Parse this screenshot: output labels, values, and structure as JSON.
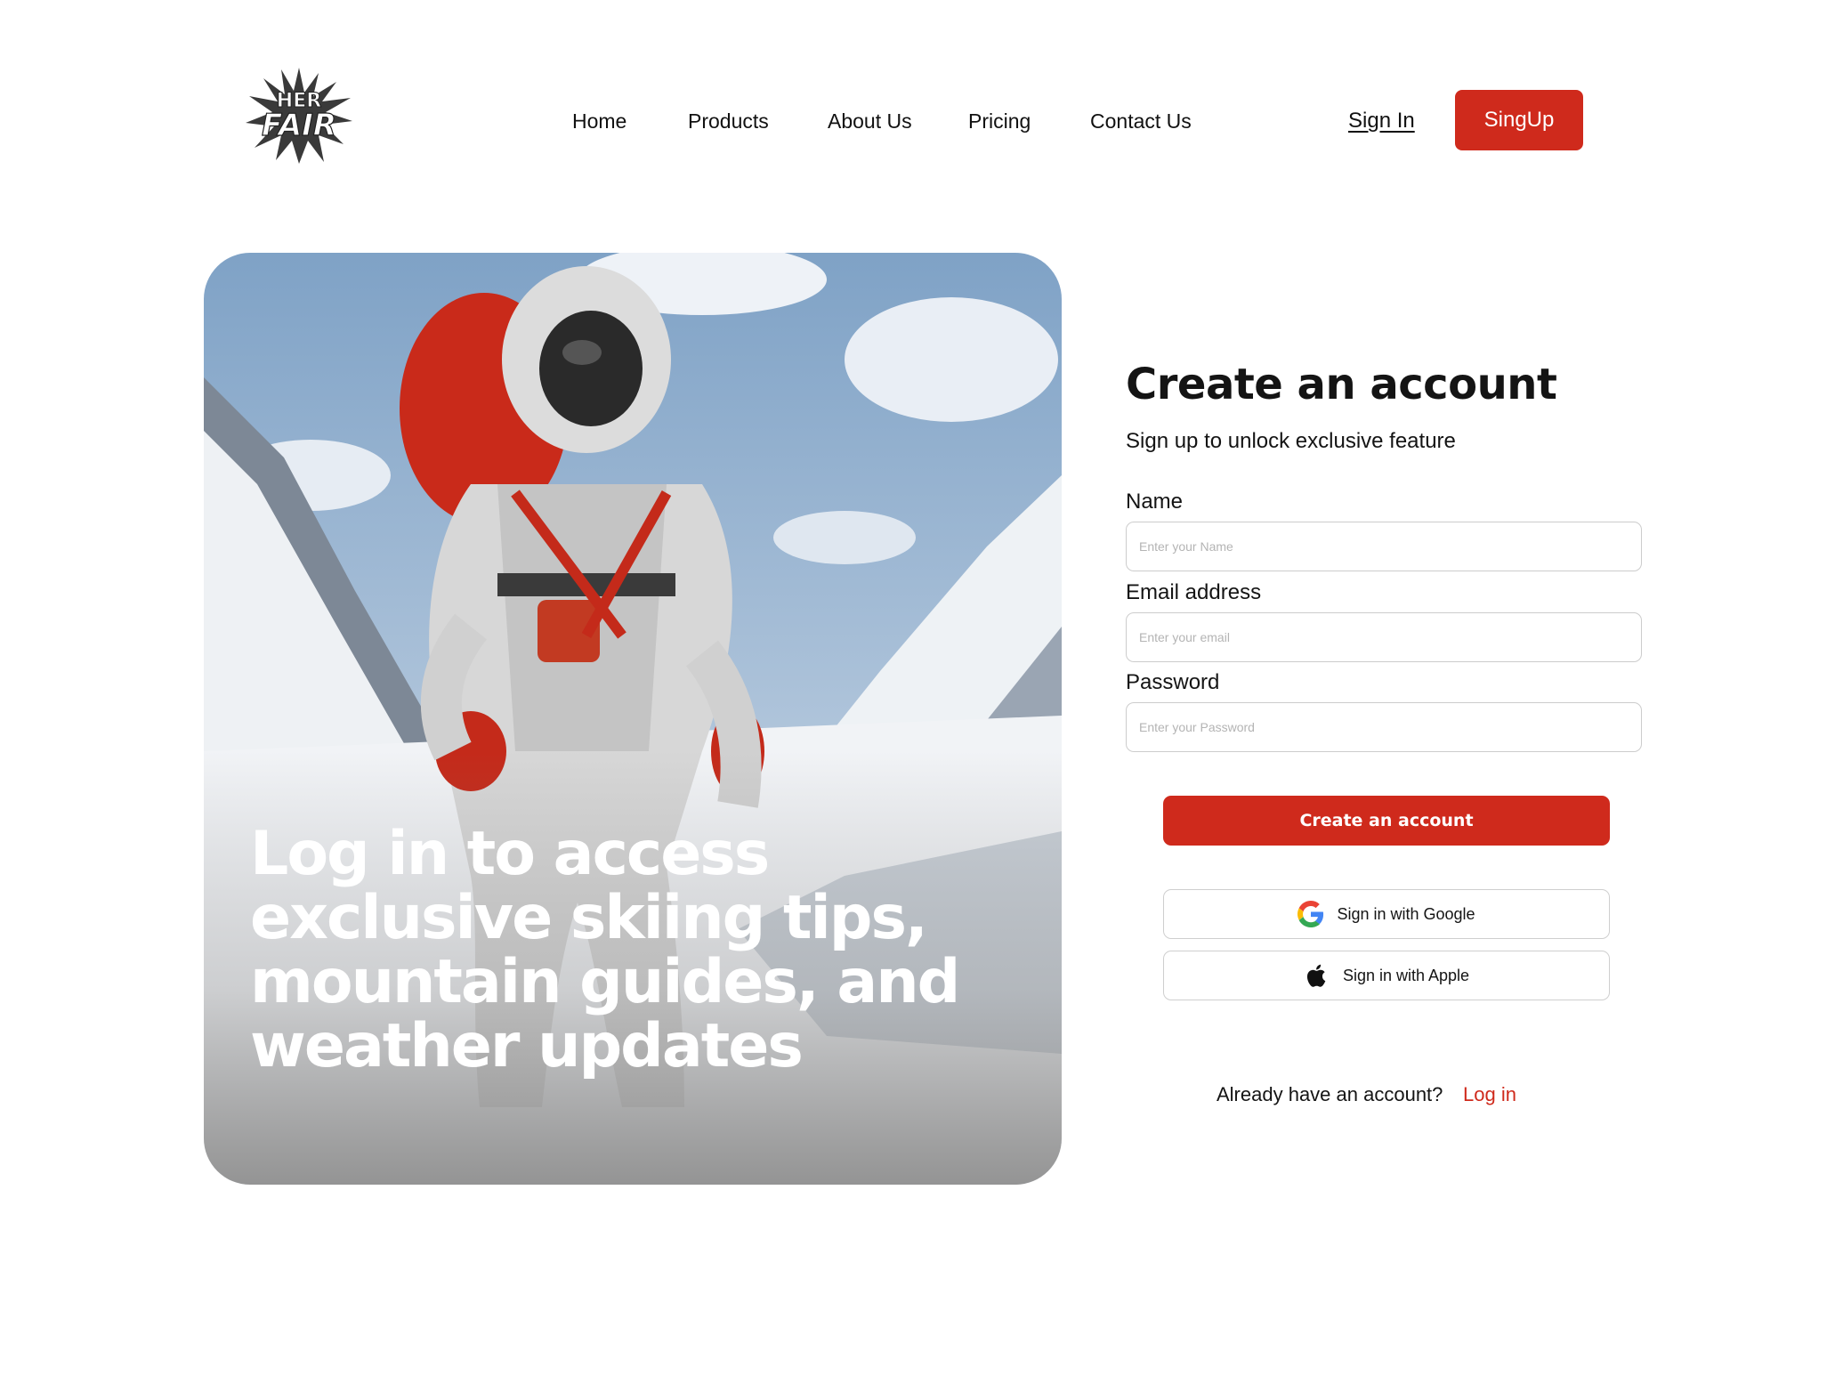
{
  "brand": {
    "logo_line1": "HER",
    "logo_line2": "FAIR"
  },
  "nav": {
    "items": [
      {
        "label": "Home"
      },
      {
        "label": "Products"
      },
      {
        "label": "About Us"
      },
      {
        "label": "Pricing"
      },
      {
        "label": "Contact Us"
      }
    ],
    "sign_in": "Sign In",
    "sign_up": "SingUp"
  },
  "hero": {
    "headline": "Log in to access exclusive skiing tips, mountain guides, and weather updates"
  },
  "form": {
    "title": "Create an account",
    "subtitle": "Sign up to unlock exclusive feature",
    "fields": [
      {
        "label": "Name",
        "placeholder": "Enter your Name",
        "value": ""
      },
      {
        "label": "Email address",
        "placeholder": "Enter your email",
        "value": ""
      },
      {
        "label": "Password",
        "placeholder": "Enter your Password",
        "value": ""
      }
    ],
    "submit": "Create an account",
    "google": "Sign in with Google",
    "apple": "Sign in with Apple",
    "already": "Already have an account?",
    "login": "Log in"
  },
  "icons": {
    "google": "google-icon",
    "apple": "apple-icon"
  },
  "colors": {
    "accent": "#cf2a1c",
    "text": "#141414",
    "border": "#cccccc"
  }
}
